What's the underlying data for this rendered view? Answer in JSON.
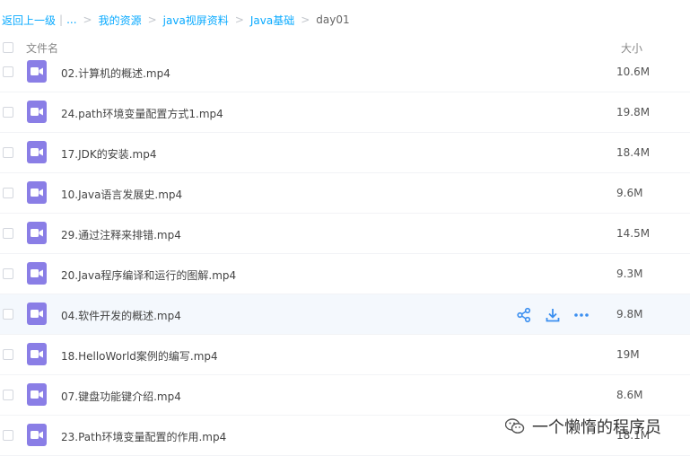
{
  "breadcrumb": {
    "back": "返回上一级",
    "bar": "|",
    "ellipsis": "...",
    "sep": ">",
    "items": [
      "我的资源",
      "java视屏资料",
      "Java基础"
    ],
    "current": "day01"
  },
  "header": {
    "name": "文件名",
    "size": "大小"
  },
  "files": [
    {
      "name": "02.计算机的概述.mp4",
      "size": "10.6M"
    },
    {
      "name": "24.path环境变量配置方式1.mp4",
      "size": "19.8M"
    },
    {
      "name": "17.JDK的安装.mp4",
      "size": "18.4M"
    },
    {
      "name": "10.Java语言发展史.mp4",
      "size": "9.6M"
    },
    {
      "name": "29.通过注释来排错.mp4",
      "size": "14.5M"
    },
    {
      "name": "20.Java程序编译和运行的图解.mp4",
      "size": "9.3M"
    },
    {
      "name": "04.软件开发的概述.mp4",
      "size": "9.8M"
    },
    {
      "name": "18.HelloWorld案例的编写.mp4",
      "size": "19M"
    },
    {
      "name": "07.键盘功能键介绍.mp4",
      "size": "8.6M"
    },
    {
      "name": "23.Path环境变量配置的作用.mp4",
      "size": "18.1M"
    }
  ],
  "hover_row_index": 6,
  "row_actions": [
    "share-icon",
    "download-icon",
    "more-icon"
  ],
  "watermark": {
    "text": "一个懒惰的程序员"
  },
  "colors": {
    "link": "#09aaff",
    "file_icon": "#8a7ee6",
    "hover_bg": "#f4f8fd",
    "action": "#3b8ff0"
  }
}
